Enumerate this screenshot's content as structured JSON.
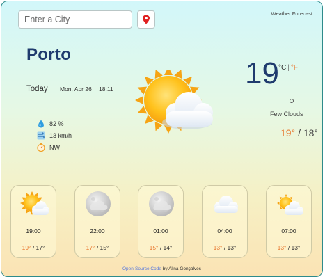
{
  "search": {
    "placeholder": "Enter a City",
    "value": ""
  },
  "location_button": {
    "icon": "location-pin-icon"
  },
  "brand": "Weather Forecast",
  "city": "Porto",
  "date_row": {
    "today_label": "Today",
    "date": "Mon, Apr 26",
    "time": "18:11"
  },
  "current": {
    "temperature": "19",
    "unit_c": "°C",
    "unit_separator": "|",
    "unit_f": "°F",
    "description": "Few Clouds",
    "high": "19°",
    "low": "18°",
    "hilo_separator": "/",
    "icon": "sun-behind-cloud-icon"
  },
  "details": {
    "humidity": "82 %",
    "wind_speed": "13 km/h",
    "wind_direction": "NW"
  },
  "forecast": [
    {
      "time": "19:00",
      "high": "19°",
      "low": "17°",
      "icon": "sun-behind-cloud-icon"
    },
    {
      "time": "22:00",
      "high": "17°",
      "low": "15°",
      "icon": "moon-cloud-icon"
    },
    {
      "time": "01:00",
      "high": "15°",
      "low": "14°",
      "icon": "moon-cloud-icon"
    },
    {
      "time": "04:00",
      "high": "13°",
      "low": "13°",
      "icon": "cloud-icon"
    },
    {
      "time": "07:00",
      "high": "13°",
      "low": "13°",
      "icon": "sun-behind-cloud-icon"
    }
  ],
  "forecast_separator": " / ",
  "footer": {
    "link_text": "Open-Source Code",
    "suffix": " by Alina Gonçalves"
  },
  "colors": {
    "accent_orange": "#e8782f",
    "city_blue": "#1f3b6e",
    "link_blue": "#5577dd"
  }
}
